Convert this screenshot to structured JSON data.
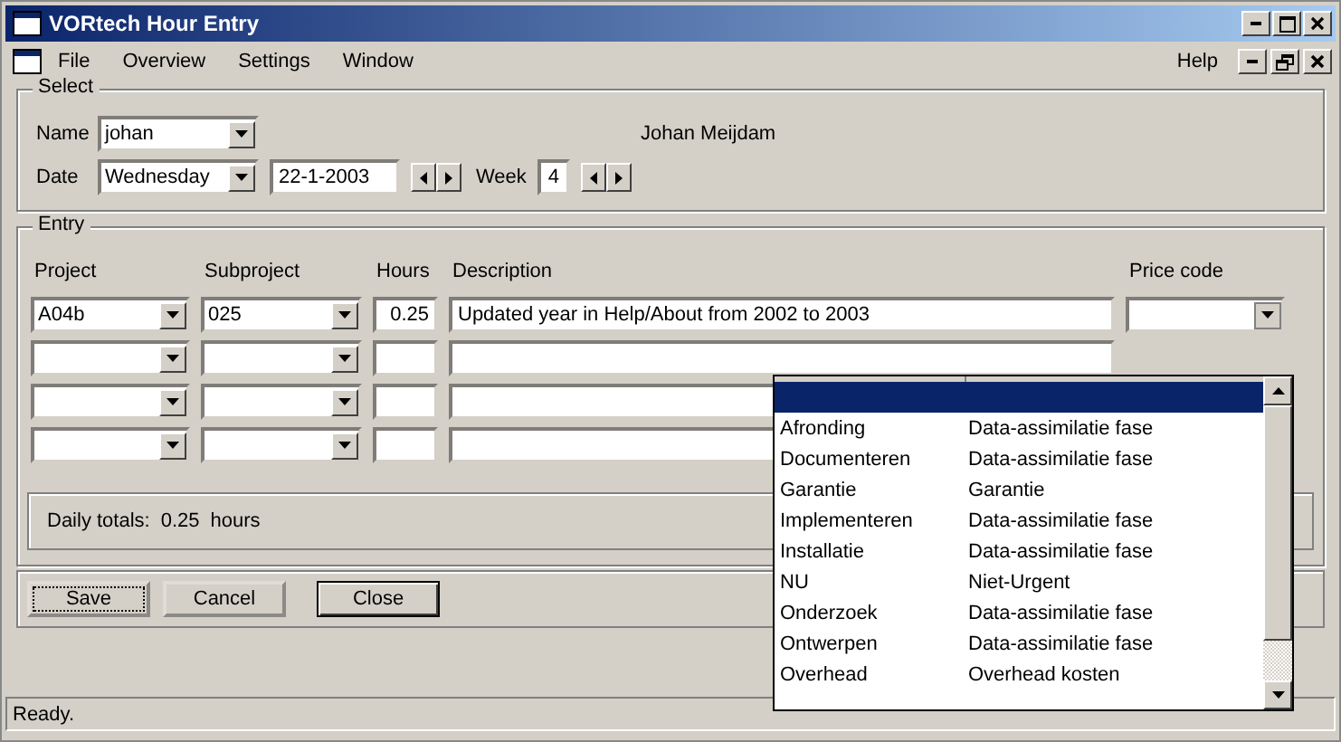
{
  "window": {
    "title": "VORtech Hour Entry"
  },
  "menu": [
    "File",
    "Overview",
    "Settings",
    "Window"
  ],
  "help_menu": "Help",
  "select": {
    "title": "Select",
    "name_label": "Name",
    "name_value": "johan",
    "full_name": "Johan Meijdam",
    "date_label": "Date",
    "day_value": "Wednesday",
    "date_value": "22-1-2003",
    "week_label": "Week",
    "week_value": "4"
  },
  "entry": {
    "title": "Entry",
    "columns": [
      "Project",
      "Subproject",
      "Hours",
      "Description",
      "Price code"
    ],
    "rows": [
      {
        "project": "A04b",
        "subproject": "025",
        "hours": "0.25",
        "description": "Updated year in Help/About from 2002 to 2003"
      },
      {},
      {},
      {}
    ]
  },
  "daily_totals": {
    "label": "Daily totals:",
    "value": "0.25",
    "unit": "hours"
  },
  "price_dropdown": {
    "items": [
      {
        "selected": true
      },
      {
        "code": "Afronding",
        "description": "Data-assimilatie fase",
        "selected": false
      },
      {
        "code": "Documenteren",
        "description": "Data-assimilatie fase",
        "selected": false
      },
      {
        "code": "Garantie",
        "description": "Garantie",
        "selected": false
      },
      {
        "code": "Implementeren",
        "description": "Data-assimilatie fase",
        "selected": false
      },
      {
        "code": "Installatie",
        "description": "Data-assimilatie fase",
        "selected": false
      },
      {
        "code": "NU",
        "description": "Niet-Urgent",
        "selected": false
      },
      {
        "code": "Onderzoek",
        "description": "Data-assimilatie fase",
        "selected": false
      },
      {
        "code": "Ontwerpen",
        "description": "Data-assimilatie fase",
        "selected": false
      },
      {
        "code": "Overhead",
        "description": "Overhead kosten",
        "selected": false
      }
    ]
  },
  "buttons": [
    {
      "label": "Save",
      "focused": true,
      "default": false
    },
    {
      "label": "Cancel",
      "focused": false,
      "default": false
    },
    {
      "label": "Close",
      "focused": false,
      "default": true
    }
  ],
  "status_bar": "Ready."
}
